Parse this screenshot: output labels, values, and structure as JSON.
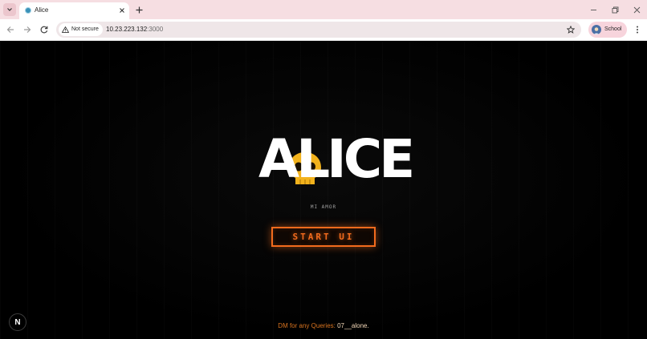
{
  "browser": {
    "tab": {
      "title": "Alice",
      "favicon": "globe-icon"
    },
    "address_bar": {
      "security_label": "Not secure",
      "url_host": "10.23.223.132",
      "url_port": ":3000"
    },
    "profile": {
      "name": "School"
    },
    "colors": {
      "tabbar_bg": "#f6dee2",
      "profile_chip": "#f7d4dc"
    }
  },
  "page": {
    "logo_text": "ALICE",
    "tagline": "MI AMOR",
    "start_button": "START UI",
    "footer": {
      "prefix": "DM for any Queries: ",
      "handle": "07__alone."
    },
    "dev_badge": "N",
    "colors": {
      "accent": "#f26b1d",
      "footer_text": "#d8731f",
      "skull": "#f2b21c",
      "background": "#000000"
    }
  }
}
